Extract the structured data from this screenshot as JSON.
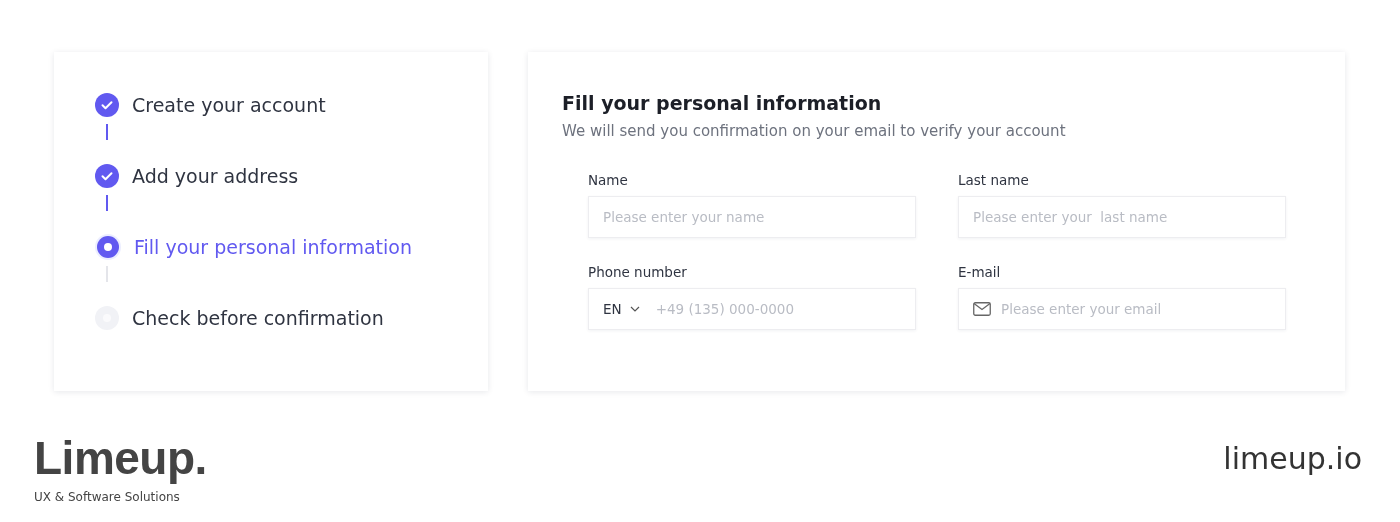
{
  "steps": [
    {
      "label": "Create your account",
      "done": true,
      "selected": false
    },
    {
      "label": "Add your address",
      "done": true,
      "selected": false
    },
    {
      "label": "Fill your personal information",
      "done": false,
      "selected": true
    },
    {
      "label": "Check before confirmation",
      "done": false,
      "selected": false
    }
  ],
  "form": {
    "title": "Fill your personal information",
    "subtitle": "We will send you confirmation on your email to verify your account",
    "fields": [
      {
        "kind": "text",
        "label": "Name",
        "placeholder": "Please enter your name"
      },
      {
        "kind": "text",
        "label": "Last name",
        "placeholder": "Please enter your  last name"
      },
      {
        "kind": "phone",
        "label": "Phone number",
        "country": "EN",
        "placeholder": "+49 (135) 000-0000"
      },
      {
        "kind": "email",
        "label": "E-mail",
        "placeholder": "Please enter your email"
      }
    ]
  },
  "brand": {
    "logo": "Limeup.",
    "tagline": "UX & Software Solutions",
    "site": "limeup.io"
  }
}
